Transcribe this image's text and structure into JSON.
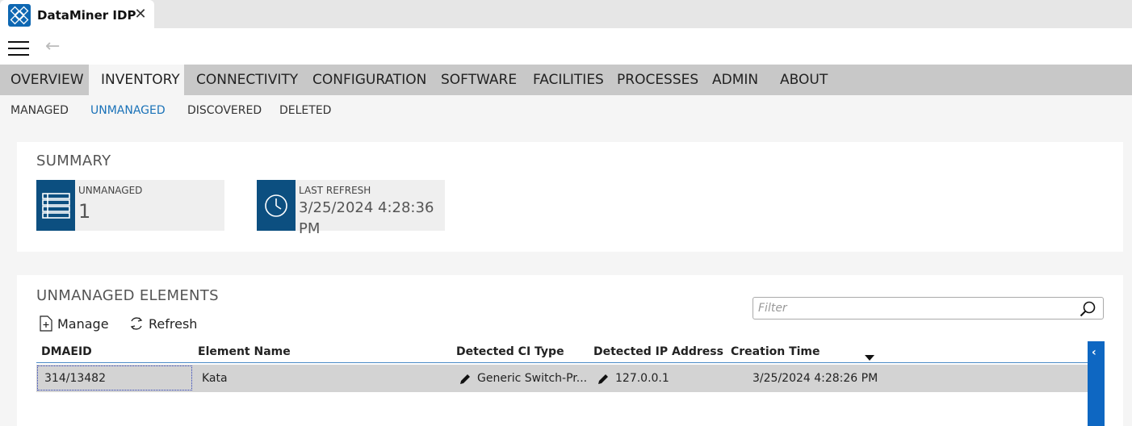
{
  "app": {
    "tab_title": "DataMiner IDP",
    "close_glyph": "✕",
    "back_glyph": "←"
  },
  "main_nav": {
    "items": [
      "OVERVIEW",
      "INVENTORY",
      "CONNECTIVITY",
      "CONFIGURATION",
      "SOFTWARE",
      "FACILITIES",
      "PROCESSES",
      "ADMIN",
      "ABOUT"
    ],
    "active": "INVENTORY"
  },
  "sub_nav": {
    "items": [
      "MANAGED",
      "UNMANAGED",
      "DISCOVERED",
      "DELETED"
    ],
    "active": "UNMANAGED"
  },
  "summary": {
    "title": "SUMMARY",
    "unmanaged_label": "UNMANAGED",
    "unmanaged_value": "1",
    "refresh_label": "LAST REFRESH",
    "refresh_value": "3/25/2024 4:28:36 PM"
  },
  "elements": {
    "title": "UNMANAGED ELEMENTS",
    "manage_label": "Manage",
    "refresh_label": "Refresh",
    "filter_placeholder": "Filter",
    "columns": [
      "DMAEID",
      "Element Name",
      "Detected CI Type",
      "Detected IP Address",
      "Creation Time"
    ],
    "sort_column": "Creation Time",
    "sort_direction": "descending",
    "rows": [
      {
        "dmaeid": "314/13482",
        "name": "Kata",
        "ci_type": "Generic Switch-Pr...",
        "ip": "127.0.0.1",
        "created": "3/25/2024 4:28:26 PM"
      }
    ]
  },
  "colors": {
    "accent": "#0e67b2",
    "tile_icon_bg": "#0c4f80",
    "nav_bg": "#c8c8c8",
    "active_subnav": "#1a72b8",
    "selected_row": "#d3d3d3"
  }
}
